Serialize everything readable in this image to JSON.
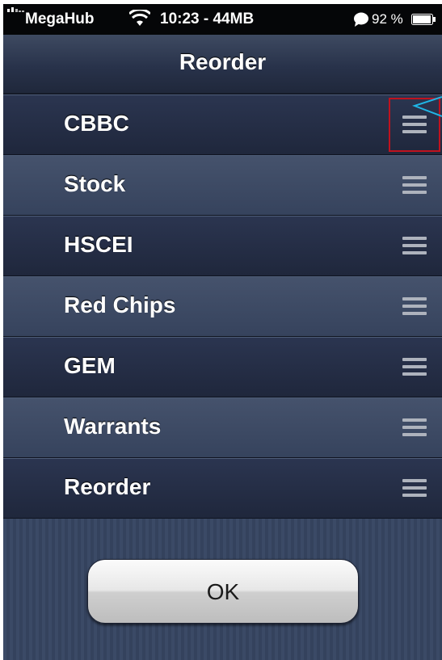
{
  "status_bar": {
    "carrier": "MegaHub",
    "time": "10:23 - 44MB",
    "battery_pct": "92 %"
  },
  "nav": {
    "title": "Reorder"
  },
  "list": {
    "items": [
      {
        "label": "CBBC"
      },
      {
        "label": "Stock"
      },
      {
        "label": "HSCEI"
      },
      {
        "label": "Red Chips"
      },
      {
        "label": "GEM"
      },
      {
        "label": "Warrants"
      },
      {
        "label": "Reorder"
      }
    ]
  },
  "footer": {
    "ok_label": "OK"
  },
  "colors": {
    "highlight": "#c0121e",
    "annotation": "#1fb6e6"
  }
}
